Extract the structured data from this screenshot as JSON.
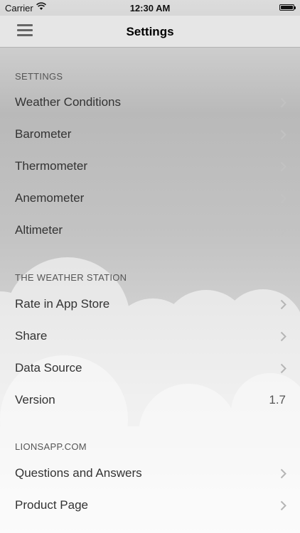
{
  "status_bar": {
    "carrier": "Carrier",
    "time": "12:30 AM"
  },
  "nav": {
    "title": "Settings"
  },
  "sections": [
    {
      "header": "SETTINGS",
      "rows": [
        {
          "label": "Weather Conditions"
        },
        {
          "label": "Barometer"
        },
        {
          "label": "Thermometer"
        },
        {
          "label": "Anemometer"
        },
        {
          "label": "Altimeter"
        }
      ]
    },
    {
      "header": "THE WEATHER STATION",
      "rows": [
        {
          "label": "Rate in App Store"
        },
        {
          "label": "Share"
        },
        {
          "label": "Data Source"
        },
        {
          "label": "Version",
          "value": "1.7"
        }
      ]
    },
    {
      "header": "LIONSAPP.COM",
      "rows": [
        {
          "label": "Questions and Answers"
        },
        {
          "label": "Product Page"
        }
      ]
    }
  ],
  "icons": {
    "menu": "hamburger-menu-icon",
    "chevron": "chevron-right-icon",
    "wifi": "wifi-icon",
    "battery": "battery-icon"
  }
}
